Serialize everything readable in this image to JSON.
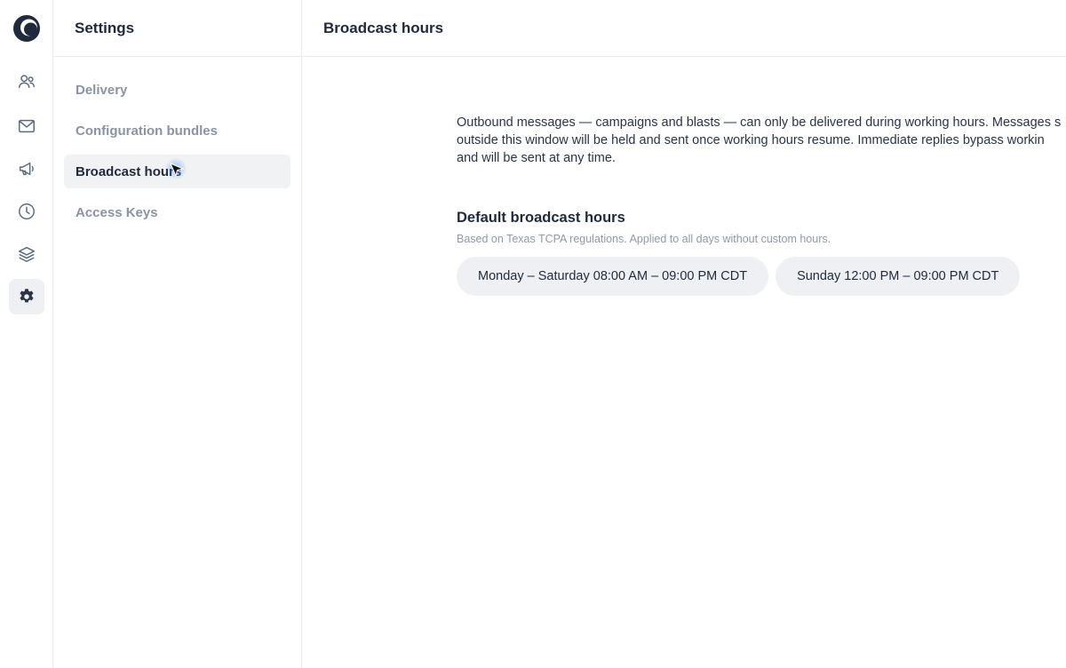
{
  "app": {
    "logo_icon": "crescent-logo-icon",
    "rail_items": [
      {
        "name": "contacts",
        "icon": "people-icon",
        "active": false
      },
      {
        "name": "inbox",
        "icon": "envelope-icon",
        "active": false
      },
      {
        "name": "campaigns",
        "icon": "megaphone-icon",
        "active": false
      },
      {
        "name": "history",
        "icon": "clock-icon",
        "active": false
      },
      {
        "name": "layers",
        "icon": "layers-icon",
        "active": false
      },
      {
        "name": "settings",
        "icon": "gear-icon",
        "active": true
      }
    ]
  },
  "subnav": {
    "title": "Settings",
    "items": [
      {
        "label": "Delivery",
        "active": false
      },
      {
        "label": "Configuration bundles",
        "active": false
      },
      {
        "label": "Broadcast hours",
        "active": true
      },
      {
        "label": "Access Keys",
        "active": false
      }
    ]
  },
  "main": {
    "title": "Broadcast hours",
    "description_lines": [
      "Outbound messages — campaigns and blasts — can only be delivered during working hours. Messages s",
      "outside this window will be held and sent once working hours resume. Immediate replies bypass workin",
      "and will be sent at any time."
    ],
    "section": {
      "title": "Default broadcast hours",
      "subtitle": "Based on Texas TCPA regulations. Applied to all days without custom hours.",
      "pills": [
        "Monday – Saturday 08:00 AM – 09:00 PM CDT",
        "Sunday 12:00 PM – 09:00 PM CDT"
      ]
    }
  },
  "colors": {
    "text_primary": "#1f2a3c",
    "text_muted": "#8b94a3",
    "active_bg": "#f1f2f4",
    "pill_bg": "#eff0f3",
    "border": "#e8eaee"
  }
}
